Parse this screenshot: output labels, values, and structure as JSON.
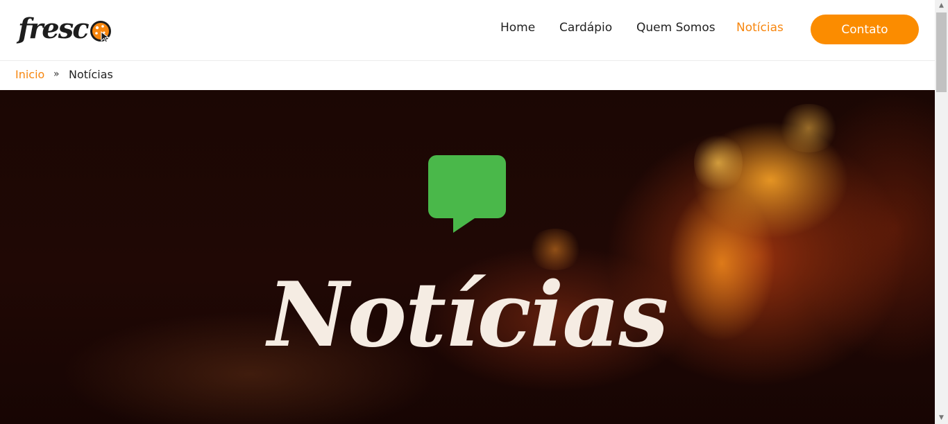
{
  "header": {
    "logo_text": "fresc",
    "nav": [
      {
        "label": "Home",
        "active": false
      },
      {
        "label": "Cardápio",
        "active": false
      },
      {
        "label": "Quem Somos",
        "active": false
      },
      {
        "label": "Notícias",
        "active": true
      }
    ],
    "cta_label": "Contato"
  },
  "breadcrumb": {
    "home": "Inicio",
    "separator": "»",
    "current": "Notícias"
  },
  "hero": {
    "icon": "chat-bubble-icon",
    "title": "Notícias"
  },
  "colors": {
    "accent": "#fb8c00",
    "accent_text": "#f7860e",
    "icon_green": "#4ab84a",
    "hero_title": "#f5ece3",
    "hero_bg": "#1b0704"
  }
}
